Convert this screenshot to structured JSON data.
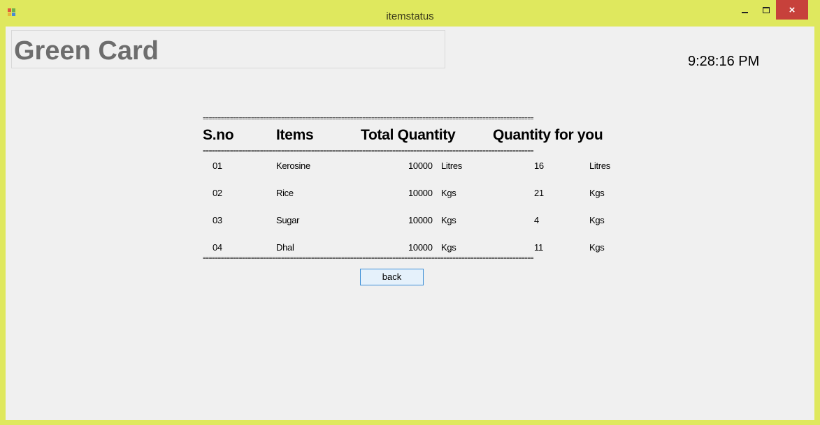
{
  "window": {
    "title": "itemstatus",
    "minimize_glyph": "minimize-icon",
    "maximize_glyph": "maximize-icon",
    "close_label": "×"
  },
  "header": {
    "card_title": "Green Card",
    "clock": "9:28:16 PM"
  },
  "table": {
    "separator": "==============================================================================================================",
    "columns": [
      "S.no",
      "Items",
      "Total Quantity",
      "Quantity for you"
    ],
    "rows": [
      {
        "sno": "01",
        "item": "Kerosine",
        "total": "10000",
        "total_unit": "Litres",
        "yours": "16",
        "yours_unit": "Litres"
      },
      {
        "sno": "02",
        "item": "Rice",
        "total": "10000",
        "total_unit": "Kgs",
        "yours": "21",
        "yours_unit": "Kgs"
      },
      {
        "sno": "03",
        "item": "Sugar",
        "total": "10000",
        "total_unit": "Kgs",
        "yours": "4",
        "yours_unit": "Kgs"
      },
      {
        "sno": "04",
        "item": "Dhal",
        "total": "10000",
        "total_unit": "Kgs",
        "yours": "11",
        "yours_unit": "Kgs"
      }
    ]
  },
  "actions": {
    "back_label": "back"
  },
  "colors": {
    "frame": "#dfe85e",
    "client_bg": "#f0f0f0",
    "title_gray": "#6d6d6d",
    "close_red": "#c7413b",
    "button_border": "#3c8ed6"
  }
}
